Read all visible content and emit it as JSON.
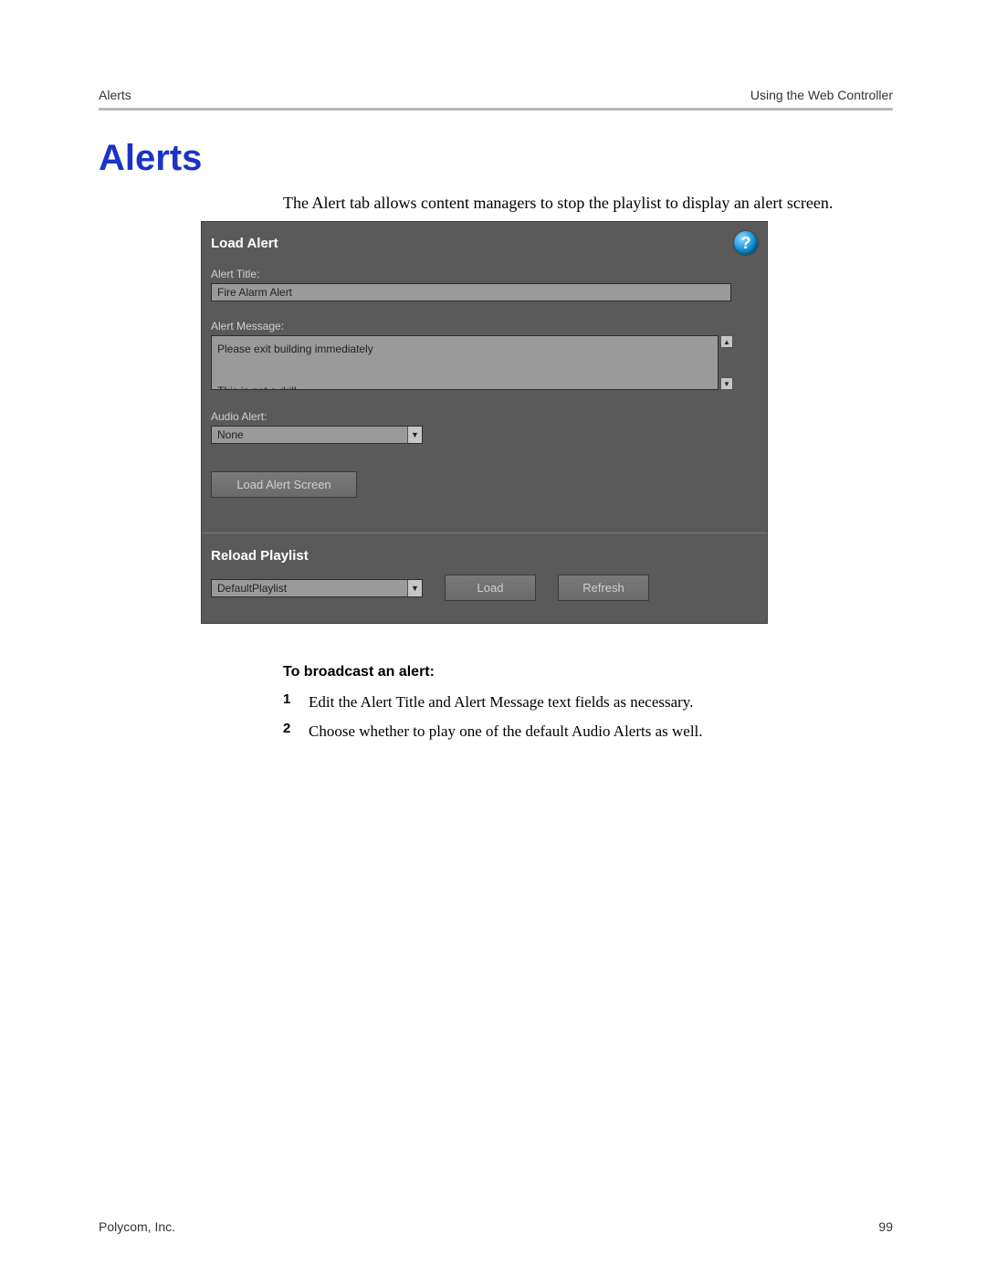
{
  "header": {
    "left": "Alerts",
    "right": "Using the Web Controller"
  },
  "title": "Alerts",
  "intro": "The Alert tab allows content managers to stop the playlist to display an alert screen.",
  "panel": {
    "load_alert_title": "Load Alert",
    "help_glyph": "?",
    "alert_title_label": "Alert Title:",
    "alert_title_value": "Fire Alarm Alert",
    "alert_message_label": "Alert Message:",
    "alert_message_value": "Please exit building immediately\n\nThis is not a drill",
    "audio_alert_label": "Audio Alert:",
    "audio_alert_value": "None",
    "load_alert_button": "Load Alert Screen",
    "reload_title": "Reload Playlist",
    "playlist_value": "DefaultPlaylist",
    "load_button": "Load",
    "refresh_button": "Refresh"
  },
  "instructions": {
    "heading": "To broadcast an alert:",
    "steps": [
      {
        "n": "1",
        "text": "Edit the Alert Title and Alert Message text fields as necessary."
      },
      {
        "n": "2",
        "text": "Choose whether to play one of the default Audio Alerts as well."
      }
    ]
  },
  "footer": {
    "left": "Polycom, Inc.",
    "right": "99"
  }
}
